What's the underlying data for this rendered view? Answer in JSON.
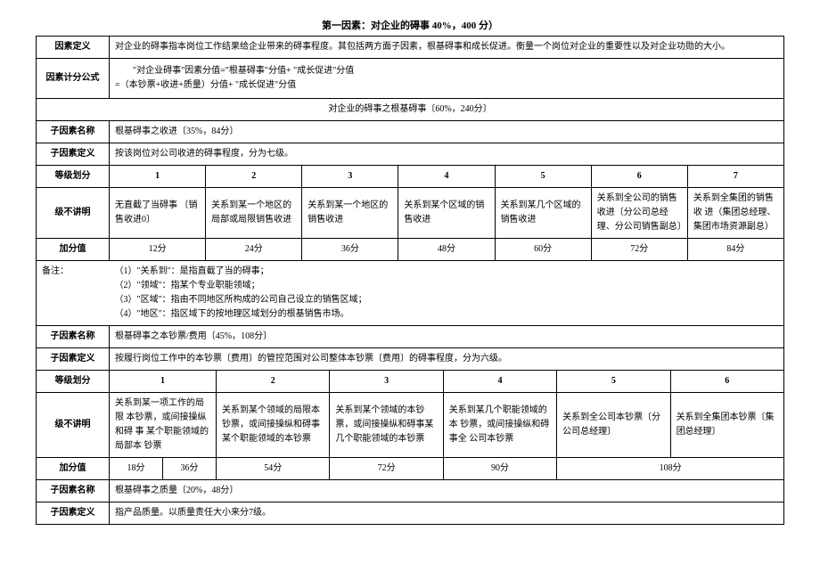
{
  "title": "第一因素：对企业的碍事 40%，400 分）",
  "rows": {
    "factor_def_label": "因素定义",
    "factor_def_text": "对企业的碍事指本岗位工作结果给企业带来的碍事程度。其包括两方面子因素，根基碍事和成长促进。衡量一个岗位对企业的重要性以及对企业功勋的大小。",
    "formula_label": "因素计分公式",
    "formula_line1": "\"对企业碍事\"因素分值=\"根基碍事\"分值+ \"成长促进\"分值",
    "formula_line2": "=（本钞票+收进+质量）分值+ \"成长促进\"分值",
    "section_header": "对企业的碍事之根基碍事〔60%，240分〕",
    "sub1_name_label": "子因素名称",
    "sub1_name_text": "根基碍事之收进〔35%，84分〕",
    "sub1_def_label": "子因素定义",
    "sub1_def_text": "按该岗位对公司收进的碍事程度，分为七级。",
    "level_div_label": "等级划分",
    "level_exp_label": "级不讲明",
    "score_label": "加分值",
    "levels1": {
      "l1": "1",
      "l2": "2",
      "l3": "3",
      "l4": "4",
      "l5": "5",
      "l6": "6",
      "l7": "7",
      "d1": "无直截了当碍事 〔销售收进0〕",
      "d2": "关系到某一个地区的 局部或局限销售收进",
      "d3": "关系到某一个地区的 销售收进",
      "d4": "关系到某个区域的销 售收进",
      "d5": "关系到某几个区域的 销售收进",
      "d6": "关系到全公司的销售 收进〔分公司总经理、分公司销售副总〕",
      "d7": "关系到全集团的销售 收 进（集团总经理、 集团市场资源副总）",
      "s1": "12分",
      "s2": "24分",
      "s3": "36分",
      "s4": "48分",
      "s5": "60分",
      "s6": "72分",
      "s7": "84分"
    },
    "remark_label": "备注：",
    "remark1": "（1）\"关系到\"：是指直截了当的碍事；",
    "remark2": "（2）\"领域\"：指某个专业职能领域；",
    "remark3": "（3）\"区域\"：指由不同地区所构成的公司自己设立的销售区域；",
    "remark4": "（4）\"地区\"：指区域下的按地理区域划分的根基销售市场。",
    "sub2_name_text": "根基碍事之本钞票/费用〔45%，108分〕",
    "sub2_def_text": "按履行岗位工作中的本钞票〔费用〕的管控范围对公司整体本钞票〔费用〕的碍事程度，分为六级。",
    "levels2": {
      "l1": "1",
      "l2": "2",
      "l3": "3",
      "l4": "4",
      "l5": "5",
      "l6": "6",
      "d1a": "关系到某一项工作的局限 本钞票，或间接操纵和碍 事 某个职能领域的局部本 钞票",
      "d1b": "关系到某个领域的局限本 钞票，或间接操纵和碍事 某个职能领域的本钞票",
      "d2": "关系到某个领域的本钞 票，或间接操纵和碍事某 几个职能领域的本钞票",
      "d3": "关系到某几个职能领域的 本 钞票，或间接操纵和碍 事全 公司本钞票",
      "d4": "关系到全公司本钞票〔分 公司总经理〕",
      "d5": "关系到全集团本钞票〔集 团总经理〕",
      "s1": "18分",
      "s2": "36分",
      "s3": "54分",
      "s4": "72分",
      "s5": "90分",
      "s6": "108分"
    },
    "sub3_name_text": "根基碍事之质量〔20%，48分〕",
    "sub3_def_text": "指产品质量。以质量责任大小来分7级。"
  }
}
